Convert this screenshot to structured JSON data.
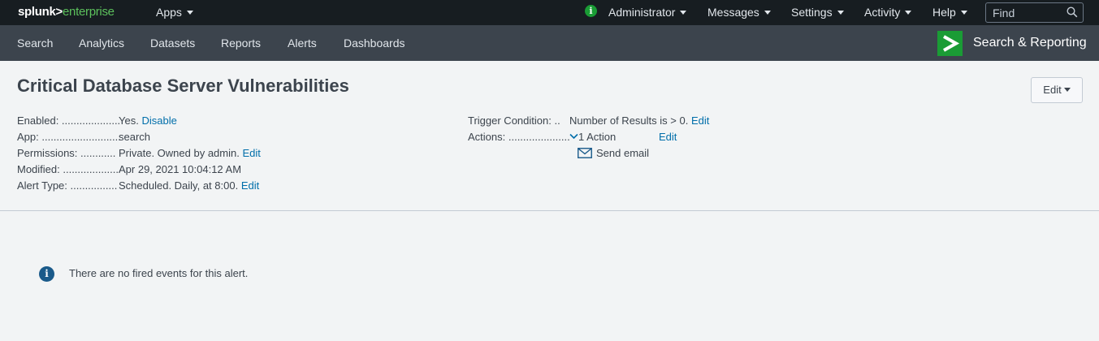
{
  "topbar": {
    "logo_part1": "splunk>",
    "logo_part2": "enterprise",
    "apps": "Apps",
    "administrator": "Administrator",
    "messages": "Messages",
    "settings": "Settings",
    "activity": "Activity",
    "help": "Help",
    "find_placeholder": "Find",
    "info_icon": "i"
  },
  "nav": {
    "items": [
      "Search",
      "Analytics",
      "Datasets",
      "Reports",
      "Alerts",
      "Dashboards"
    ],
    "app_title": "Search & Reporting"
  },
  "alert": {
    "title": "Critical Database Server Vulnerabilities",
    "edit_button": "Edit",
    "left": [
      {
        "label": "Enabled: ....................",
        "value": "Yes.",
        "link": "Disable"
      },
      {
        "label": "App: ...........................",
        "value": "search",
        "link": ""
      },
      {
        "label": "Permissions: ............",
        "value": "Private. Owned by admin.",
        "link": "Edit"
      },
      {
        "label": "Modified: ...................",
        "value": "Apr 29, 2021 10:04:12 AM",
        "link": ""
      },
      {
        "label": "Alert Type: ................",
        "value": "Scheduled. Daily, at 8:00.",
        "link": "Edit"
      }
    ],
    "trigger_label": "Trigger Condition: ..",
    "trigger_value": "Number of Results is > 0.",
    "trigger_link": "Edit",
    "actions_label": "Actions: .....................",
    "actions_count": "1 Action",
    "actions_link": "Edit",
    "action_item": "Send email"
  },
  "message": {
    "icon": "i",
    "text": "There are no fired events for this alert."
  },
  "colors": {
    "topbar_bg": "#171d21",
    "navbar_bg": "#3c444d",
    "accent_green": "#1a9c35",
    "link_blue": "#006eaa"
  }
}
